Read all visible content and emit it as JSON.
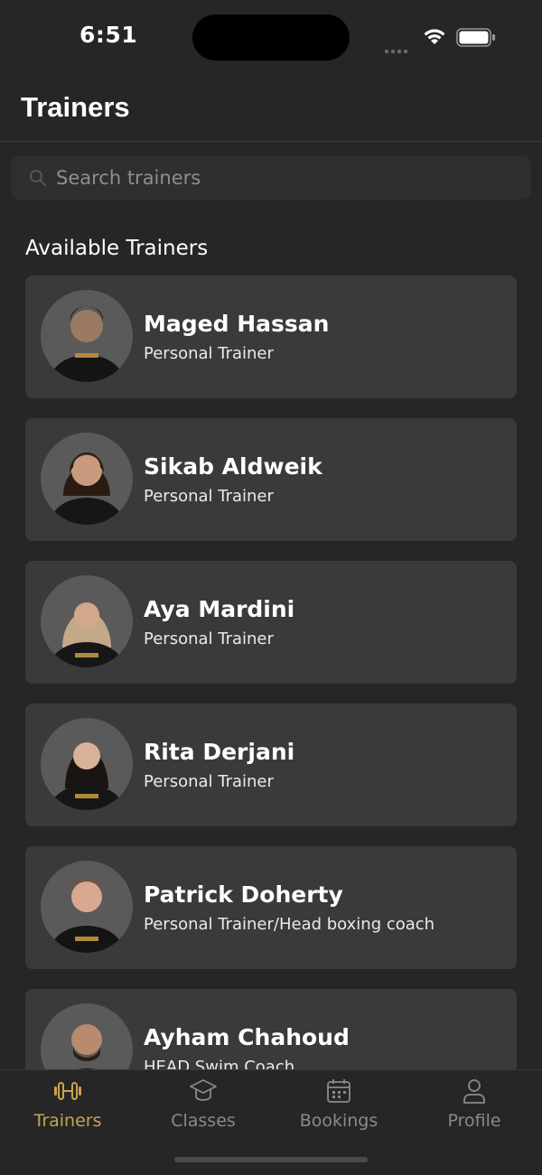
{
  "status_bar": {
    "time": "6:51"
  },
  "header": {
    "title": "Trainers"
  },
  "search": {
    "placeholder": "Search trainers"
  },
  "section_title": "Available Trainers",
  "trainers": [
    {
      "name": "Maged Hassan",
      "role": "Personal Trainer"
    },
    {
      "name": "Sikab Aldweik",
      "role": "Personal Trainer"
    },
    {
      "name": "Aya Mardini",
      "role": "Personal Trainer"
    },
    {
      "name": "Rita Derjani",
      "role": "Personal Trainer"
    },
    {
      "name": "Patrick Doherty",
      "role": "Personal Trainer/Head boxing coach"
    },
    {
      "name": "Ayham Chahoud",
      "role": "HEAD Swim Coach"
    }
  ],
  "tab_bar": {
    "items": [
      {
        "label": "Trainers",
        "icon": "dumbbell-icon",
        "active": true
      },
      {
        "label": "Classes",
        "icon": "graduation-cap-icon",
        "active": false
      },
      {
        "label": "Bookings",
        "icon": "calendar-icon",
        "active": false
      },
      {
        "label": "Profile",
        "icon": "person-icon",
        "active": false
      }
    ]
  },
  "colors": {
    "background": "#262626",
    "card": "#3a3a3a",
    "accent": "#c9a44e",
    "inactive": "#8a8a8a"
  }
}
